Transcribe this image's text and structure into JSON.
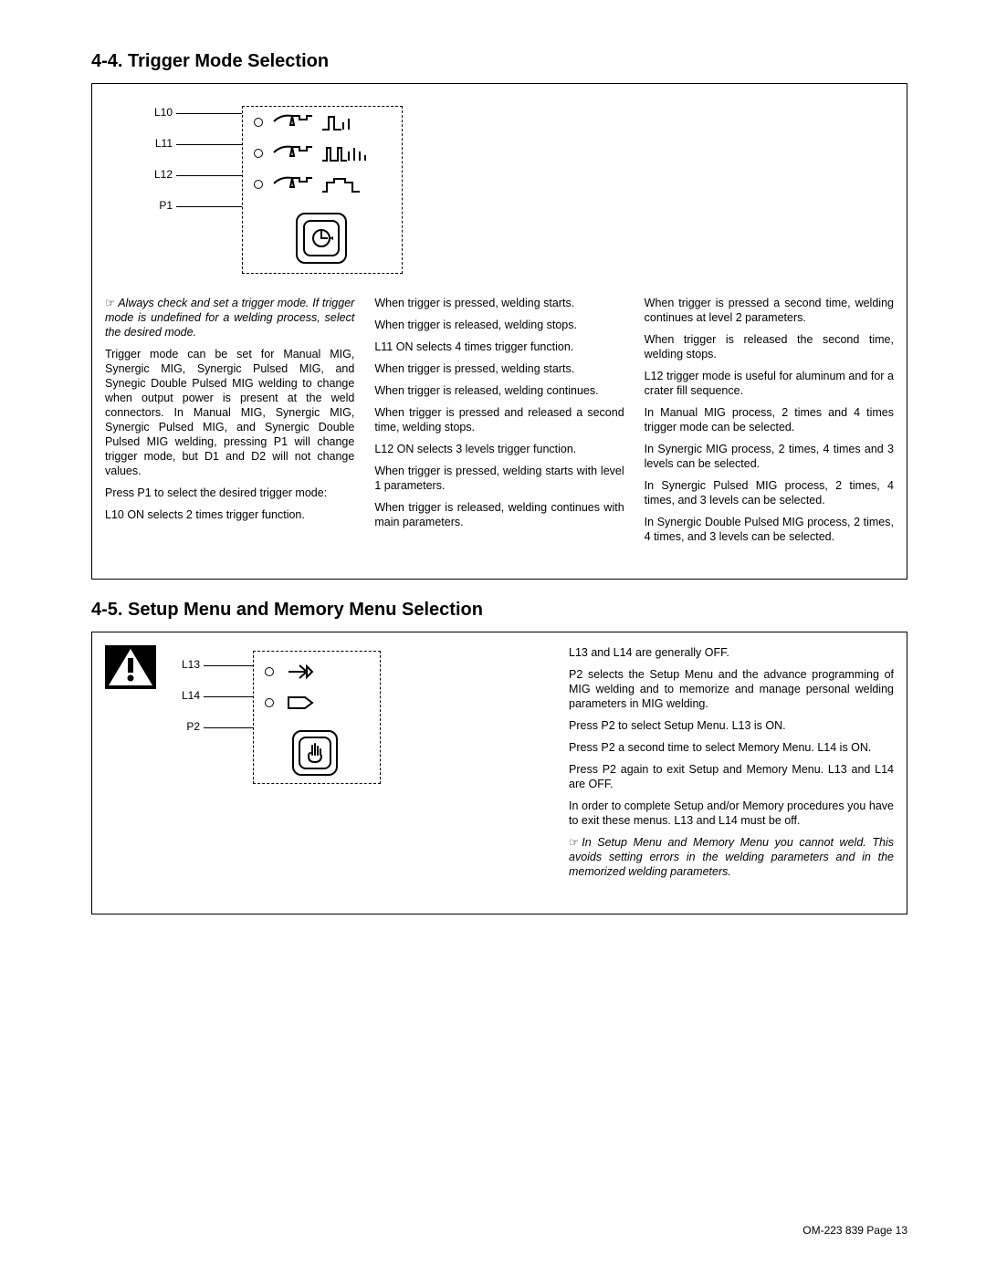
{
  "section4_4": {
    "title": "4-4.  Trigger Mode Selection",
    "labels": {
      "L10": "L10",
      "L11": "L11",
      "L12": "L12",
      "P1": "P1"
    },
    "col1": {
      "note": "Always check and set a trigger mode. If trigger mode is undefined for a welding process, select the desired mode.",
      "p1": "Trigger mode can be set for Manual MIG, Synergic MIG, Synergic Pulsed MIG, and Synegic Double Pulsed MIG welding to change when output power is present at the weld connectors. In Manual MIG, Synergic MIG, Synergic Pulsed MIG, and Synergic Double Pulsed MIG welding, pressing P1 will change trigger mode, but D1 and D2 will not change values.",
      "p2": "Press P1 to select the desired trigger mode:",
      "p3": "L10 ON selects 2 times trigger function."
    },
    "col2": {
      "p1": "When trigger is pressed, welding starts.",
      "p2": "When trigger is released, welding stops.",
      "p3": "L11 ON selects 4 times trigger function.",
      "p4": "When trigger is pressed, welding starts.",
      "p5": "When trigger is released, welding continues.",
      "p6": "When trigger is pressed and released a second time, welding stops.",
      "p7": "L12 ON selects 3 levels trigger function.",
      "p8": "When trigger is pressed, welding starts with  level 1 parameters.",
      "p9": "When trigger is released, welding continues with main parameters."
    },
    "col3": {
      "p1": "When trigger is pressed a second time, welding continues at level 2 parameters.",
      "p2": "When trigger is released the second time, welding stops.",
      "p3": "L12 trigger mode is useful for aluminum and for a crater fill sequence.",
      "p4": "In Manual MIG process, 2 times and 4 times trigger mode can be selected.",
      "p5": "In Synergic MIG process, 2 times, 4 times and 3 levels can be selected.",
      "p6": "In Synergic Pulsed MIG process, 2 times, 4 times, and 3 levels can be selected.",
      "p7": "In Synergic Double Pulsed MIG process, 2 times, 4 times, and 3 levels can be selected."
    }
  },
  "section4_5": {
    "title": "4-5.  Setup Menu and Memory Menu Selection",
    "labels": {
      "L13": "L13",
      "L14": "L14",
      "P2": "P2"
    },
    "right": {
      "p1": "L13 and L14 are generally OFF.",
      "p2": "P2 selects the Setup Menu and the advance programming of MIG welding and to memorize and manage personal welding parameters in MIG welding.",
      "p3": "Press P2 to select Setup Menu. L13 is ON.",
      "p4": "Press P2 a second time to select Memory Menu. L14 is ON.",
      "p5": "Press P2 again to exit Setup and Memory Menu. L13 and L14 are OFF.",
      "p6": "In order to complete Setup and/or Memory procedures you have to exit these menus. L13 and L14 must be off.",
      "note": "In Setup Menu and Memory Menu you cannot weld. This avoids setting errors in the welding parameters and in the memorized welding parameters."
    }
  },
  "footer": "OM-223 839 Page 13"
}
